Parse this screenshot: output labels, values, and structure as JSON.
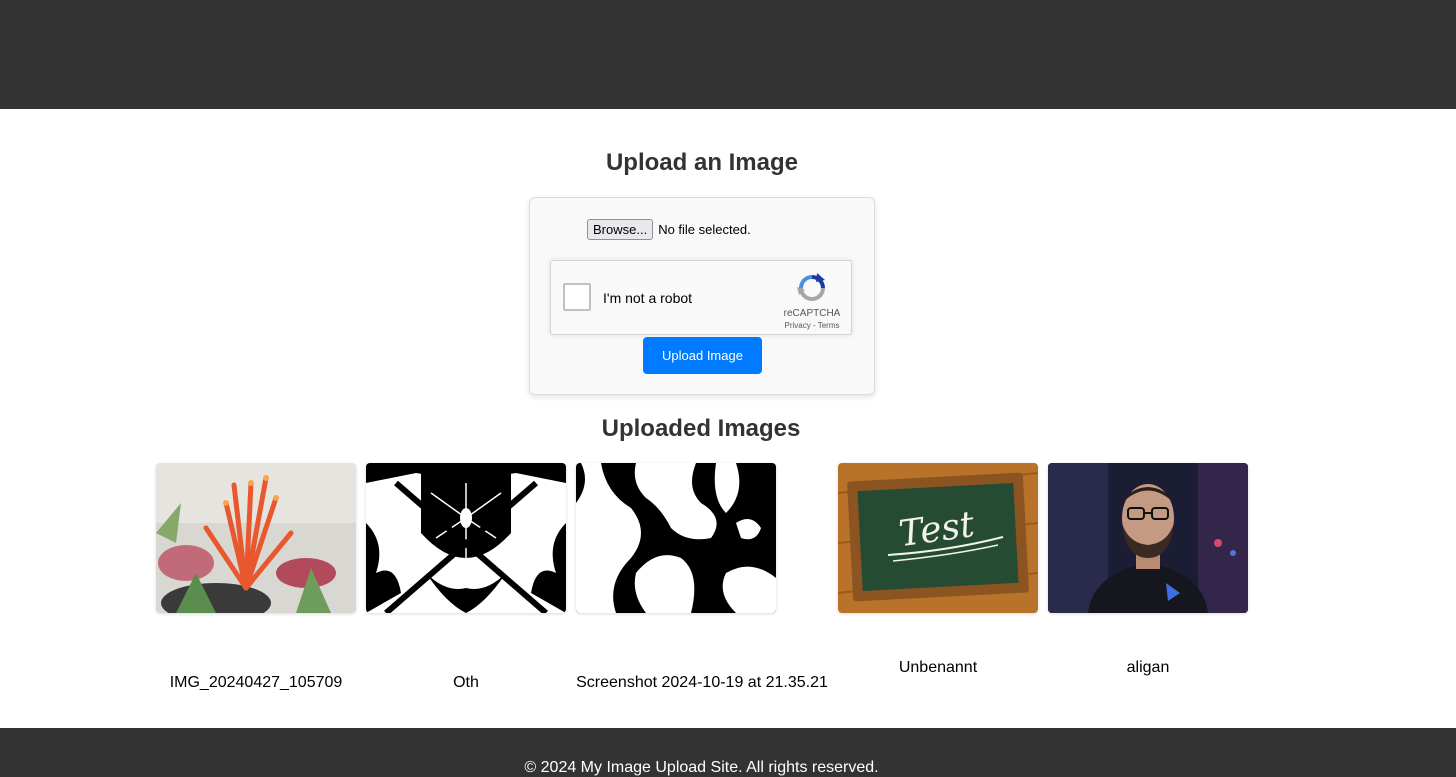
{
  "upload_section": {
    "title": "Upload an Image",
    "browse_label": "Browse...",
    "file_status": "No file selected.",
    "recaptcha": {
      "label": "I'm not a robot",
      "brand": "reCAPTCHA",
      "links": "Privacy - Terms"
    },
    "submit_label": "Upload Image"
  },
  "gallery": {
    "title": "Uploaded Images",
    "images": [
      {
        "name": "IMG_20240427_105709",
        "icon": "aloe-flower-photo"
      },
      {
        "name": "Oth",
        "icon": "black-white-emblem-art"
      },
      {
        "name": "Screenshot 2024-10-19 at 21.35.21",
        "icon": "black-white-blob-screenshot"
      },
      {
        "name": "Unbenannt",
        "icon": "chalkboard-test-photo"
      },
      {
        "name": "aligan",
        "icon": "portrait-photo"
      }
    ]
  },
  "footer": {
    "text": "© 2024 My Image Upload Site. All rights reserved."
  },
  "colors": {
    "header_bg": "#333333",
    "accent": "#007bff"
  }
}
